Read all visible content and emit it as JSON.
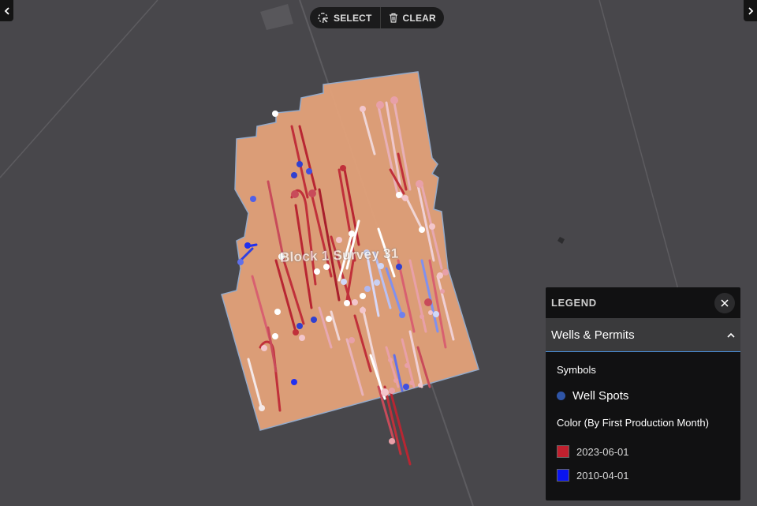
{
  "toolbar": {
    "select_label": "SELECT",
    "clear_label": "CLEAR",
    "select_icon": "select-lasso-icon",
    "clear_icon": "trash-icon"
  },
  "nav": {
    "left_icon": "chevron-left-icon",
    "right_icon": "chevron-right-icon"
  },
  "map": {
    "area_label": "Block 1 Survey 31",
    "area_fill": "#e3a27a",
    "background": "#48474b"
  },
  "legend": {
    "title": "LEGEND",
    "close_icon": "close-icon",
    "section_title": "Wells & Permits",
    "section_icon": "chevron-up-icon",
    "symbols_heading": "Symbols",
    "symbol_label": "Well Spots",
    "symbol_color": "#2f55a7",
    "color_heading": "Color (By First Production Month)",
    "colors": [
      {
        "label": "2023-06-01",
        "color": "#c0202e"
      },
      {
        "label": "2010-04-01",
        "color": "#0a14f0"
      }
    ]
  }
}
